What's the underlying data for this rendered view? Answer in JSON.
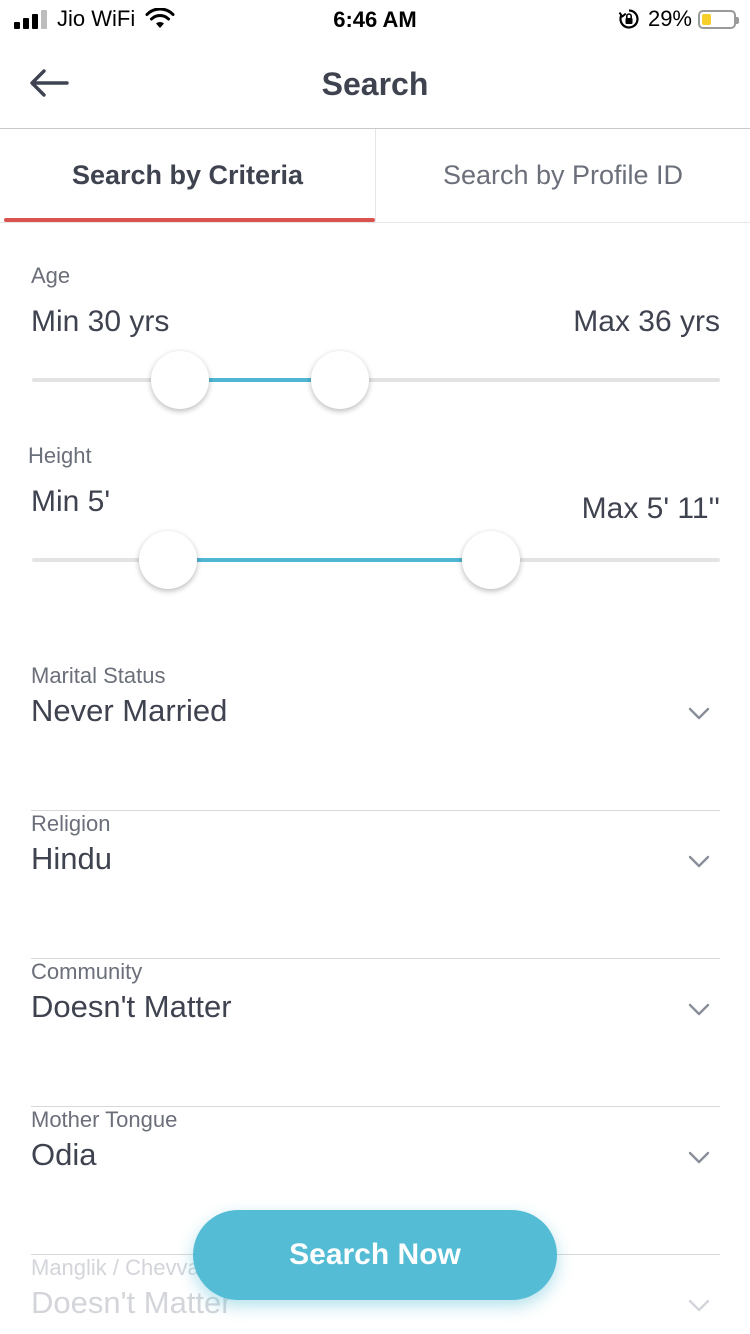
{
  "status_bar": {
    "carrier": "Jio WiFi",
    "time": "6:46 AM",
    "battery_percent": "29%",
    "battery_level": 0.29,
    "battery_color": "#f6cf2a"
  },
  "header": {
    "title": "Search",
    "back_icon": "arrow-left-icon"
  },
  "tabs": [
    {
      "label": "Search by Criteria",
      "active": true
    },
    {
      "label": "Search by Profile ID",
      "active": false
    }
  ],
  "age": {
    "label": "Age",
    "min_label": "Min 30 yrs",
    "max_label": "Max 36 yrs"
  },
  "height": {
    "label": "Height",
    "min_label": "Min 5'",
    "max_label": "Max 5' 11''"
  },
  "fields": [
    {
      "label": "Marital Status",
      "value": "Never Married"
    },
    {
      "label": "Religion",
      "value": "Hindu"
    },
    {
      "label": "Community",
      "value": "Doesn't Matter"
    },
    {
      "label": "Mother Tongue",
      "value": "Odia"
    },
    {
      "label": "Manglik / Chevvai Dosham",
      "value": "Doesn't Matter"
    }
  ],
  "action": {
    "label": "Search Now"
  },
  "colors": {
    "accent": "#54bcd4",
    "tab_indicator": "#d9534f",
    "slider_fill": "#4fb6d3",
    "text_primary": "#3f4350",
    "text_secondary": "#6b6f7a"
  }
}
